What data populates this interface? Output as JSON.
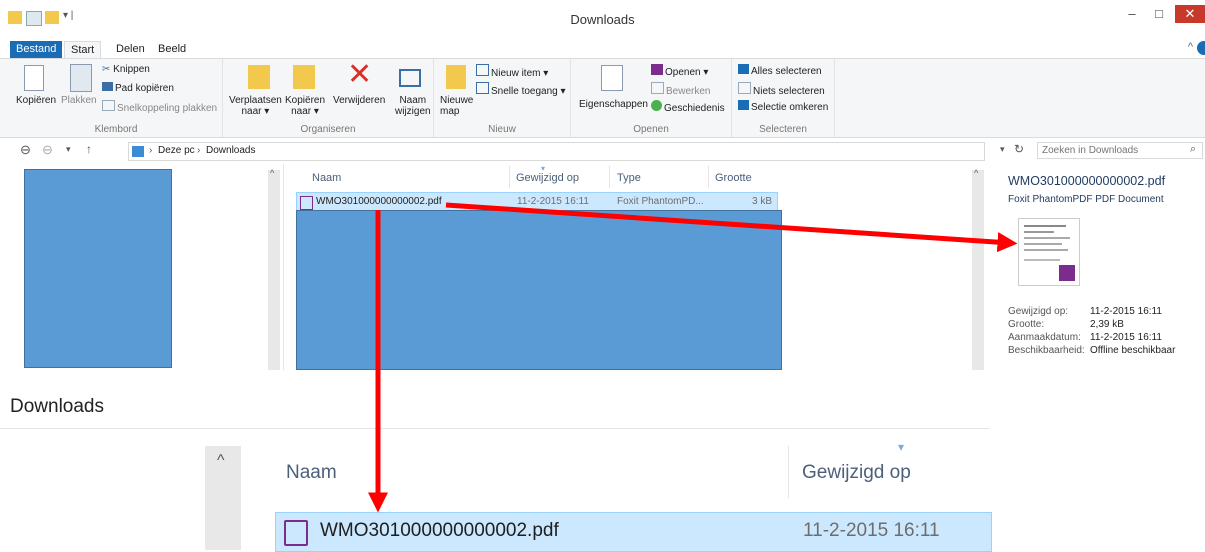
{
  "window": {
    "title": "Downloads",
    "minimize": "–",
    "maximize": "□",
    "close": "✕"
  },
  "tabs": [
    "Bestand",
    "Start",
    "Delen",
    "Beeld"
  ],
  "ribbon": {
    "clipboard": {
      "copy": "Kopiëren",
      "paste": "Plakken",
      "cut": "Knippen",
      "copy_path": "Pad kopiëren",
      "paste_shortcut": "Snelkoppeling plakken",
      "label": "Klembord"
    },
    "organize": {
      "move_l1": "Verplaatsen",
      "move_l2": "naar ▾",
      "copyto_l1": "Kopiëren",
      "copyto_l2": "naar ▾",
      "delete": "Verwijderen",
      "rename_l1": "Naam",
      "rename_l2": "wijzigen",
      "label": "Organiseren"
    },
    "new": {
      "folder_l1": "Nieuwe",
      "folder_l2": "map",
      "new_item": "Nieuw item ▾",
      "easy_access": "Snelle toegang ▾",
      "label": "Nieuw"
    },
    "open": {
      "properties": "Eigenschappen",
      "open": "Openen ▾",
      "edit": "Bewerken",
      "history": "Geschiedenis",
      "label": "Openen"
    },
    "select": {
      "all": "Alles selecteren",
      "none": "Niets selecteren",
      "invert": "Selectie omkeren",
      "label": "Selecteren"
    }
  },
  "address": {
    "path_root": "Deze pc",
    "path_sep": "›",
    "path_current": "Downloads",
    "search_placeholder": "Zoeken in Downloads"
  },
  "columns": {
    "name": "Naam",
    "modified": "Gewijzigd op",
    "type": "Type",
    "size": "Grootte"
  },
  "file": {
    "name": "WMO301000000000002.pdf",
    "modified": "11-2-2015 16:11",
    "type": "Foxit PhantomPD...",
    "size": "3 kB"
  },
  "details": {
    "filename": "WMO301000000000002.pdf",
    "filetype": "Foxit PhantomPDF PDF Document",
    "labels": [
      "Gewijzigd op:",
      "Grootte:",
      "Aanmaakdatum:",
      "Beschikbaarheid:"
    ],
    "values": [
      "11-2-2015 16:11",
      "2,39 kB",
      "11-2-2015 16:11",
      "Offline beschikbaar"
    ]
  },
  "zoom": {
    "title": "Downloads",
    "name_header": "Naam",
    "modified_header": "Gewijzigd op",
    "file_name": "WMO301000000000002.pdf",
    "file_modified": "11-2-2015 16:11"
  },
  "colors": {
    "accent": "#1a6cb5",
    "selection": "#cce8ff",
    "redaction": "#5b9bd5",
    "arrow": "#ff0000"
  }
}
